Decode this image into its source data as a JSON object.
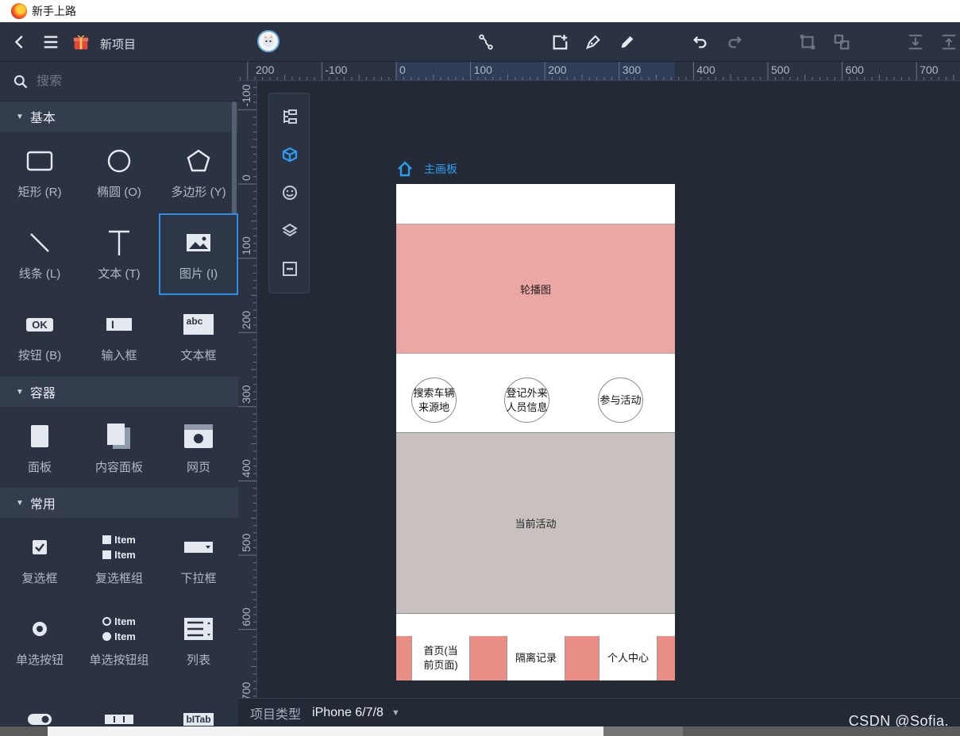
{
  "window": {
    "title": "新手上路"
  },
  "toolbar": {
    "project_name": "新项目",
    "icons": [
      "back-icon",
      "menu-icon",
      "gift-icon",
      "avatar",
      "connector-icon",
      "add-page-icon",
      "pen-icon",
      "pencil-icon",
      "undo-icon",
      "redo-icon",
      "group-icon",
      "ungroup-icon",
      "align-bottom-icon",
      "align-top-icon"
    ]
  },
  "left_panel": {
    "search_placeholder": "搜索",
    "sections": [
      {
        "title": "基本",
        "items": [
          {
            "label": "矩形 (R)",
            "icon": "rectangle-icon"
          },
          {
            "label": "椭圆 (O)",
            "icon": "ellipse-icon"
          },
          {
            "label": "多边形 (Y)",
            "icon": "polygon-icon"
          },
          {
            "label": "线条 (L)",
            "icon": "line-icon"
          },
          {
            "label": "文本 (T)",
            "icon": "text-icon"
          },
          {
            "label": "图片 (I)",
            "icon": "image-icon"
          },
          {
            "label": "按钮 (B)",
            "icon": "button-icon",
            "glyph": "OK"
          },
          {
            "label": "输入框",
            "icon": "input-icon",
            "glyph": "I"
          },
          {
            "label": "文本框",
            "icon": "textarea-icon",
            "glyph": "abc"
          }
        ]
      },
      {
        "title": "容器",
        "items": [
          {
            "label": "面板",
            "icon": "panel-icon"
          },
          {
            "label": "内容面板",
            "icon": "content-panel-icon"
          },
          {
            "label": "网页",
            "icon": "webpage-icon"
          }
        ]
      },
      {
        "title": "常用",
        "items": [
          {
            "label": "复选框",
            "icon": "checkbox-icon"
          },
          {
            "label": "复选框组",
            "icon": "checkbox-group-icon",
            "glyph": "Item"
          },
          {
            "label": "下拉框",
            "icon": "dropdown-icon"
          },
          {
            "label": "单选按钮",
            "icon": "radio-icon"
          },
          {
            "label": "单选按钮组",
            "icon": "radio-group-icon",
            "glyph": "Item"
          },
          {
            "label": "列表",
            "icon": "list-icon"
          },
          {
            "label": "",
            "icon": "toggle-icon"
          },
          {
            "label": "",
            "icon": "segmented-icon"
          },
          {
            "label": "",
            "icon": "tab-icon",
            "glyph": "bITab"
          }
        ]
      }
    ],
    "selected_item": "图片 (I)"
  },
  "rulers": {
    "top": [
      "200",
      "-100",
      "0",
      "100",
      "200",
      "300",
      "400",
      "500",
      "600",
      "700"
    ],
    "left": [
      "-100",
      "0",
      "100",
      "200",
      "300",
      "400",
      "500",
      "600",
      "700"
    ]
  },
  "float_tools": [
    "outline-icon",
    "component-icon",
    "emoji-icon",
    "layers-icon",
    "master-icon"
  ],
  "canvas": {
    "board_label": "主画板",
    "banner": "轮播图",
    "circles": [
      "搜索车辆来源地",
      "登记外来人员信息",
      "参与活动"
    ],
    "activity": "当前活动",
    "tabs": [
      "首页(当前页面)",
      "隔离记录",
      "个人中心"
    ]
  },
  "bottom": {
    "label": "项目类型",
    "value": "iPhone 6/7/8"
  },
  "watermark": "CSDN @Sofia."
}
